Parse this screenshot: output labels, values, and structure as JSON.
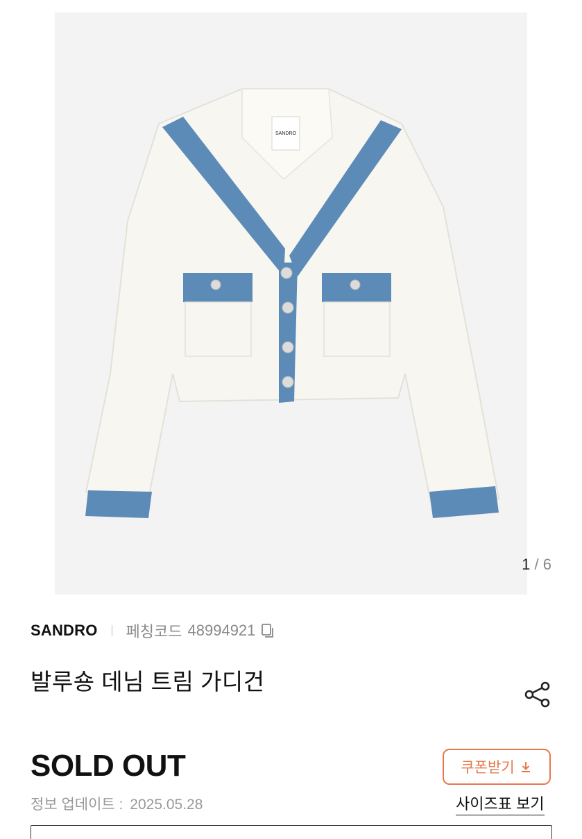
{
  "gallery": {
    "current": "1",
    "separator": "/",
    "total": "6",
    "label_tag": "SANDRO",
    "colors": {
      "background": "#f3f3f3",
      "garment": "#f7f6f0",
      "denim": "#5d8bb8"
    }
  },
  "product": {
    "brand": "SANDRO",
    "code_label": "페칭코드",
    "code_value": "48994921",
    "name": "발루숑 데님 트림 가디건",
    "status": "SOLD OUT",
    "update_label": "정보 업데이트 :",
    "update_date": "2025.05.28"
  },
  "actions": {
    "coupon_label": "쿠폰받기",
    "size_chart_label": "사이즈표 보기",
    "accent_color": "#e8784d"
  },
  "icons": {
    "copy": "copy-icon",
    "share": "share-icon",
    "download": "download-icon"
  }
}
